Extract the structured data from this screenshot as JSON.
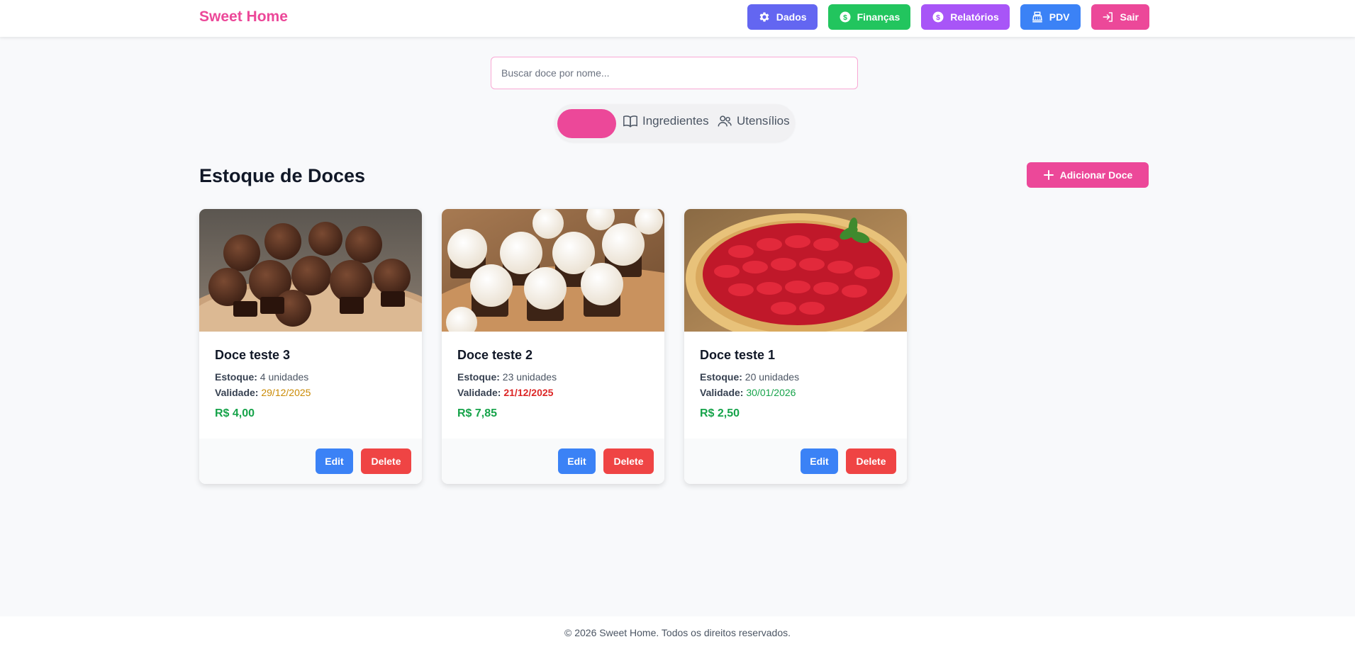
{
  "header": {
    "brand": "Sweet Home",
    "nav": [
      {
        "label": "Dados",
        "icon": "gear-icon",
        "color": "#6366f1"
      },
      {
        "label": "Finanças",
        "icon": "dollar-circle-icon",
        "color": "#22c55e"
      },
      {
        "label": "Relatórios",
        "icon": "dollar-circle-icon",
        "color": "#a855f7"
      },
      {
        "label": "PDV",
        "icon": "cash-register-icon",
        "color": "#3b82f6"
      },
      {
        "label": "Sair",
        "icon": "logout-icon",
        "color": "#ec4899"
      }
    ]
  },
  "search": {
    "placeholder": "Buscar doce por nome...",
    "value": ""
  },
  "tabs": [
    {
      "label": "",
      "active": true
    },
    {
      "label": "Ingredientes",
      "icon": "book-open-icon",
      "active": false
    },
    {
      "label": "Utensílios",
      "icon": "users-icon",
      "active": false
    }
  ],
  "section": {
    "title": "Estoque de Doces",
    "add_label": "Adicionar Doce"
  },
  "labels": {
    "stock": "Estoque:",
    "validity": "Validade:",
    "edit": "Edit",
    "delete": "Delete"
  },
  "products": [
    {
      "name": "Doce teste 3",
      "stock": "4 unidades",
      "validity": "29/12/2025",
      "validity_color": "#ca8a04",
      "price": "R$ 4,00",
      "image": "brigadeiros-photo"
    },
    {
      "name": "Doce teste 2",
      "stock": "23 unidades",
      "validity": "21/12/2025",
      "validity_color": "#dc2626",
      "price": "R$ 7,85",
      "image": "beijinhos-photo"
    },
    {
      "name": "Doce teste 1",
      "stock": "20 unidades",
      "validity": "30/01/2026",
      "validity_color": "#16a34a",
      "price": "R$ 2,50",
      "image": "strawberry-tart-photo"
    }
  ],
  "footer": {
    "text": "© 2026 Sweet Home. Todos os direitos reservados."
  }
}
